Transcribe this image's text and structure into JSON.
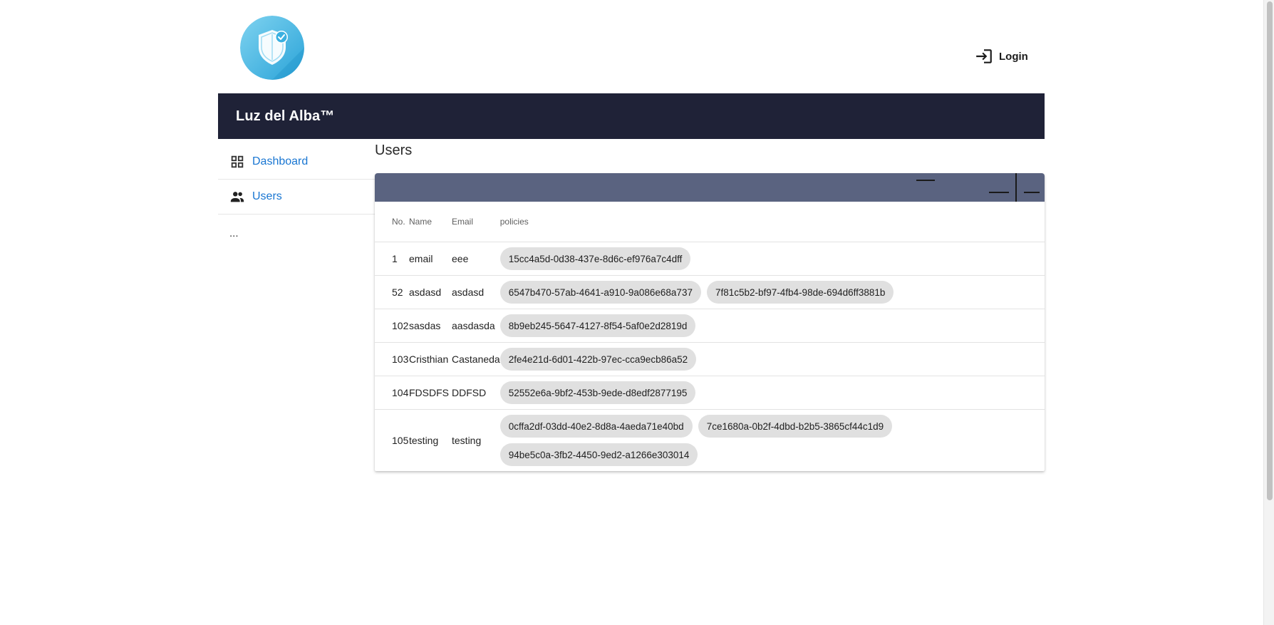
{
  "app": {
    "brand": "Luz del Alba™",
    "login_label": "Login"
  },
  "sidebar": {
    "items": [
      {
        "label": "Dashboard",
        "icon": "dashboard-icon"
      },
      {
        "label": "Users",
        "icon": "users-icon"
      }
    ],
    "more": "..."
  },
  "page": {
    "title": "Users"
  },
  "table": {
    "headers": {
      "no": "No.",
      "name": "Name",
      "email": "Email",
      "policies": "policies"
    },
    "rows": [
      {
        "no": "1",
        "name": "email",
        "email": "eee",
        "policies": [
          "15cc4a5d-0d38-437e-8d6c-ef976a7c4dff"
        ]
      },
      {
        "no": "52",
        "name": "asdasd",
        "email": "asdasd",
        "policies": [
          "6547b470-57ab-4641-a910-9a086e68a737",
          "7f81c5b2-bf97-4fb4-98de-694d6ff3881b"
        ]
      },
      {
        "no": "102",
        "name": "sasdas",
        "email": "aasdasda",
        "policies": [
          "8b9eb245-5647-4127-8f54-5af0e2d2819d"
        ]
      },
      {
        "no": "103",
        "name": "Cristhian",
        "email": "Castaneda",
        "policies": [
          "2fe4e21d-6d01-422b-97ec-cca9ecb86a52"
        ]
      },
      {
        "no": "104",
        "name": "FDSDFS",
        "email": "DDFSD",
        "policies": [
          "52552e6a-9bf2-453b-9ede-d8edf2877195"
        ]
      },
      {
        "no": "105",
        "name": "testing",
        "email": "testing",
        "policies": [
          "0cffa2df-03dd-40e2-8d8a-4aeda71e40bd",
          "7ce1680a-0b2f-4dbd-b2b5-3865cf44c1d9",
          "94be5c0a-3fb2-4450-9ed2-a1266e303014"
        ]
      }
    ]
  },
  "colors": {
    "header_bg": "#1f2237",
    "toolbar_bg": "#5a6380",
    "link": "#1976d2",
    "chip_bg": "#e0e0e0"
  }
}
